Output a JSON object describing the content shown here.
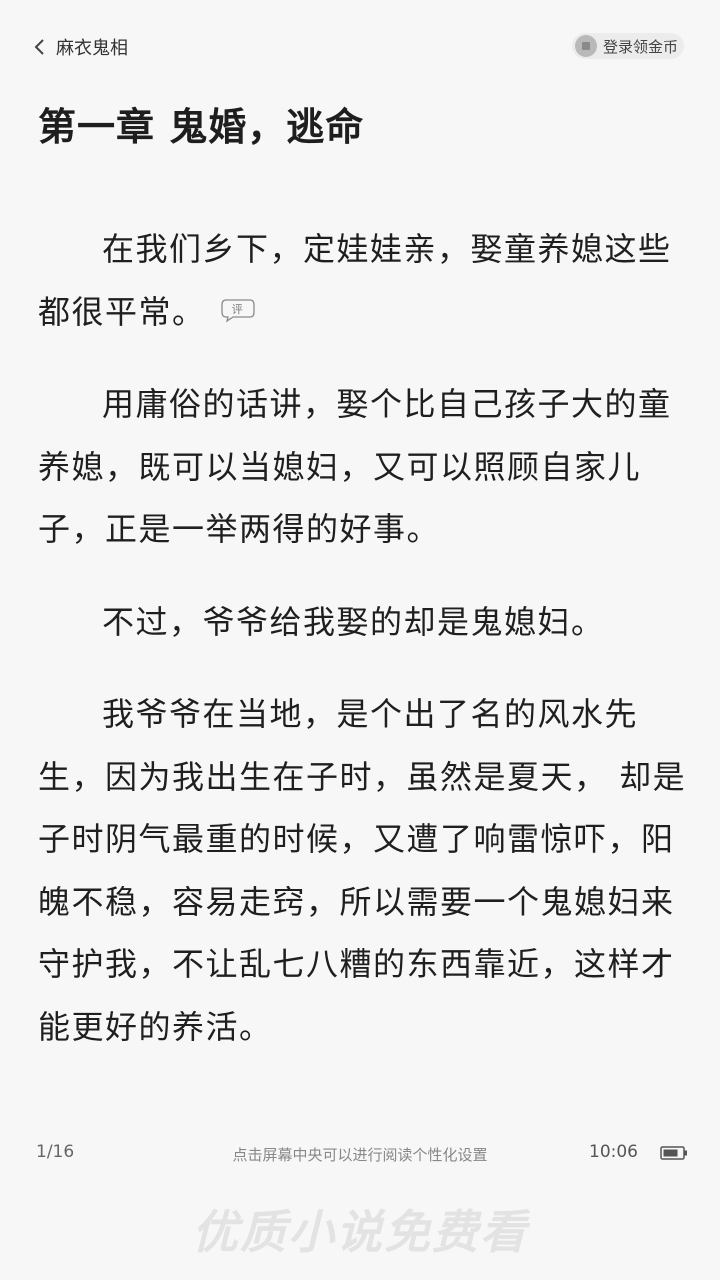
{
  "header": {
    "book_title": "麻衣鬼相",
    "login_label": "登录领金币"
  },
  "chapter": {
    "title": "第一章  鬼婚，逃命",
    "paragraphs": [
      "在我们乡下，定娃娃亲，娶童养媳这些都很平常。",
      "用庸俗的话讲，娶个比自己孩子大的童养媳，既可以当媳妇，又可以照顾自家儿子，正是一举两得的好事。",
      "不过，爷爷给我娶的却是鬼媳妇。",
      "我爷爷在当地，是个出了名的风水先生，因为我出生在子时，虽然是夏天， 却是子时阴气最重的时候，又遭了响雷惊吓，阳魄不稳，容易走窍，所以需要一个鬼媳妇来守护我，不让乱七八糟的东西靠近，这样才能更好的养活。"
    ],
    "comment_label": "评"
  },
  "footer": {
    "page": "1/16",
    "hint": "点击屏幕中央可以进行阅读个性化设置",
    "time": "10:06"
  },
  "watermark": "优质小说免费看"
}
